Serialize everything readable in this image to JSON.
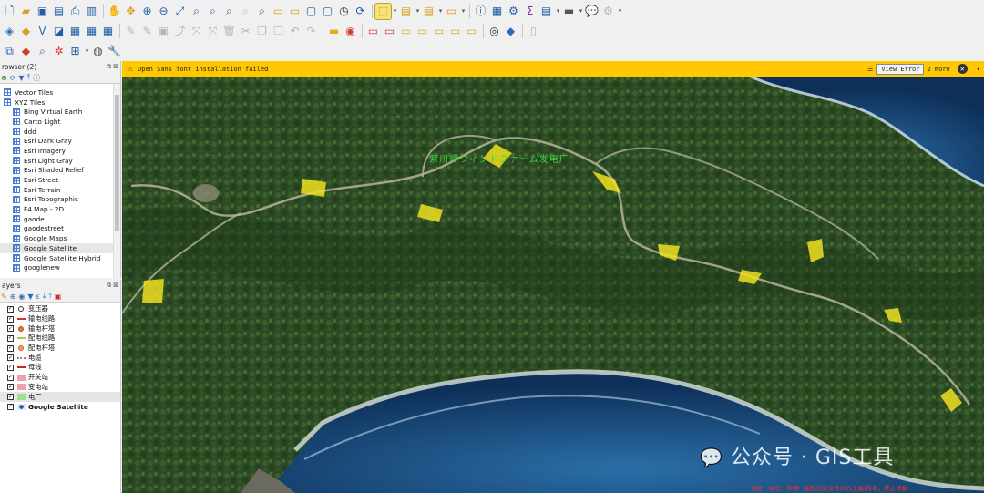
{
  "toolbar": {
    "row1_icons": [
      "new-project",
      "open-project",
      "save-project",
      "save-as",
      "print-layout",
      "layout-manager",
      "pan-hand",
      "pan-to-selection",
      "zoom-in",
      "zoom-out",
      "zoom-full",
      "zoom-to-selection",
      "zoom-to-layer",
      "zoom-native",
      "zoom-last",
      "zoom-next",
      "new-bookmark",
      "show-bookmarks",
      "new-map-view",
      "new-3d-view",
      "refresh",
      "select-features",
      "select-attributes",
      "deselect",
      "identify",
      "measure",
      "attribute-table",
      "settings",
      "statistics",
      "field-calculator",
      "map-tips",
      "annotation",
      "plugins"
    ],
    "row2_icons": [
      "digitize",
      "add-layer",
      "add-vector",
      "add-raster",
      "add-csv",
      "spatialite",
      "edit-pencil",
      "toggle-edit",
      "save-edits",
      "digitize-vertex",
      "move-feature",
      "delete",
      "cut",
      "copy",
      "paste",
      "undo",
      "redo",
      "label",
      "pin-labels",
      "highlight",
      "label-diagram",
      "move-label",
      "rotate-label",
      "change-label",
      "python",
      "gps"
    ],
    "row3_icons": [
      "node-tool",
      "locate",
      "snap",
      "measure-area",
      "identify-2",
      "globe",
      "wrench"
    ]
  },
  "browser_panel": {
    "title": "rowser (2)",
    "items": [
      {
        "label": "Vector Tiles",
        "level": 0
      },
      {
        "label": "XYZ Tiles",
        "level": 0
      },
      {
        "label": "Bing Virtual Earth",
        "level": 1
      },
      {
        "label": "Carto Light",
        "level": 1
      },
      {
        "label": "ddd",
        "level": 1
      },
      {
        "label": "Esri Dark Gray",
        "level": 1
      },
      {
        "label": "Esri Imagery",
        "level": 1
      },
      {
        "label": "Esri Light Gray",
        "level": 1
      },
      {
        "label": "Esri Shaded Relief",
        "level": 1
      },
      {
        "label": "Esri Street",
        "level": 1
      },
      {
        "label": "Esri Terrain",
        "level": 1
      },
      {
        "label": "Esri Topographic",
        "level": 1
      },
      {
        "label": "F4 Map - 2D",
        "level": 1
      },
      {
        "label": "gaode",
        "level": 1
      },
      {
        "label": "gaodestreet",
        "level": 1
      },
      {
        "label": "Google Maps",
        "level": 1
      },
      {
        "label": "Google Satellite",
        "level": 1,
        "selected": true
      },
      {
        "label": "Google Satellite Hybrid",
        "level": 1
      },
      {
        "label": "googlenew",
        "level": 1
      }
    ]
  },
  "layers_panel": {
    "title": "ayers",
    "layers": [
      {
        "label": "变压器",
        "symbol": "circle",
        "color": "#ffffff",
        "stroke": "#333333",
        "checked": true
      },
      {
        "label": "输电线路",
        "symbol": "line",
        "color": "#e03030",
        "checked": true
      },
      {
        "label": "输电杆塔",
        "symbol": "circle",
        "color": "#e07a2a",
        "stroke": "#c05010",
        "checked": true
      },
      {
        "label": "配电线路",
        "symbol": "line",
        "color": "#a8c860",
        "checked": true
      },
      {
        "label": "配电杆塔",
        "symbol": "circle",
        "color": "#f0a060",
        "stroke": "#d06020",
        "checked": true
      },
      {
        "label": "电缆",
        "symbol": "dots",
        "color": "#888888",
        "checked": true
      },
      {
        "label": "母线",
        "symbol": "line",
        "color": "#d02020",
        "checked": true
      },
      {
        "label": "开关站",
        "symbol": "box",
        "color": "#f0a0a8",
        "checked": true
      },
      {
        "label": "变电站",
        "symbol": "box",
        "color": "#f0a0a8",
        "checked": true
      },
      {
        "label": "电厂",
        "symbol": "box",
        "color": "#a0e090",
        "checked": true,
        "selected": true
      },
      {
        "label": "Google Satellite",
        "symbol": "raster",
        "color": "#2a5fb0",
        "checked": true,
        "bold": true
      }
    ]
  },
  "message_bar": {
    "text": "Open Sans font installation failed",
    "view_error_label": "View Error",
    "more_label": "2 more",
    "color": "#ffc800"
  },
  "map": {
    "label": "紫川岬ウィンドファーム发电厂",
    "watermark": "公众号 · GIS工具",
    "note": "注意：水印，声明：版权归公众号[GIS工具]所有，禁止转载"
  }
}
